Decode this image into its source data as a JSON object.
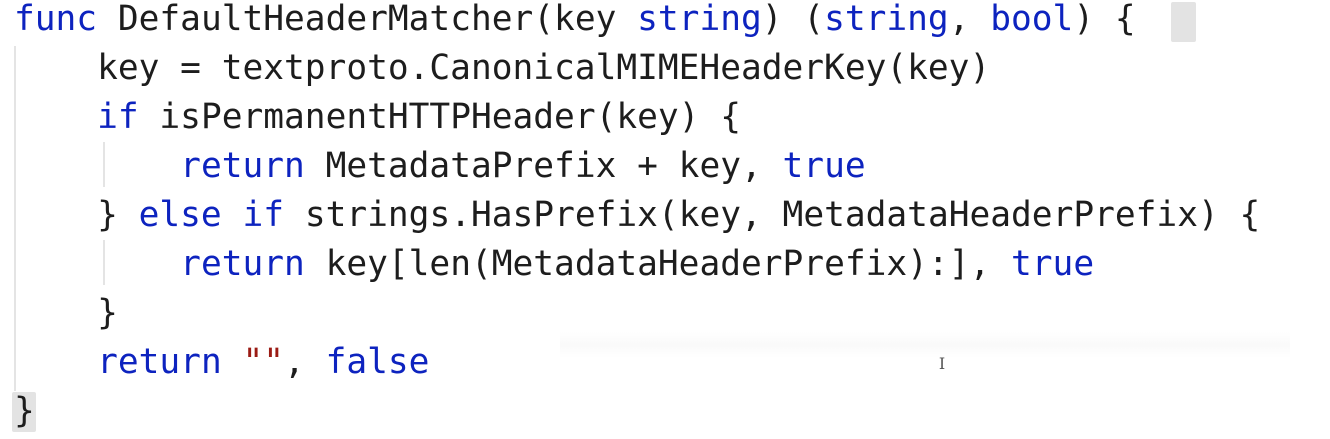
{
  "code": {
    "lines": [
      [
        {
          "t": "func",
          "c": "kw"
        },
        {
          "t": " DefaultHeaderMatcher(key ",
          "c": ""
        },
        {
          "t": "string",
          "c": "kw"
        },
        {
          "t": ") (",
          "c": ""
        },
        {
          "t": "string",
          "c": "kw"
        },
        {
          "t": ", ",
          "c": ""
        },
        {
          "t": "bool",
          "c": "kw"
        },
        {
          "t": ") {",
          "c": ""
        }
      ],
      [
        {
          "t": "    key = textproto.CanonicalMIMEHeaderKey(key)",
          "c": ""
        }
      ],
      [
        {
          "t": "    ",
          "c": ""
        },
        {
          "t": "if",
          "c": "kw"
        },
        {
          "t": " isPermanentHTTPHeader(key) {",
          "c": ""
        }
      ],
      [
        {
          "t": "        ",
          "c": ""
        },
        {
          "t": "return",
          "c": "kw"
        },
        {
          "t": " MetadataPrefix + key, ",
          "c": ""
        },
        {
          "t": "true",
          "c": "kw"
        }
      ],
      [
        {
          "t": "    } ",
          "c": ""
        },
        {
          "t": "else",
          "c": "kw"
        },
        {
          "t": " ",
          "c": ""
        },
        {
          "t": "if",
          "c": "kw"
        },
        {
          "t": " strings.HasPrefix(key, MetadataHeaderPrefix) {",
          "c": ""
        }
      ],
      [
        {
          "t": "        ",
          "c": ""
        },
        {
          "t": "return",
          "c": "kw"
        },
        {
          "t": " key[len(MetadataHeaderPrefix):], ",
          "c": ""
        },
        {
          "t": "true",
          "c": "kw"
        }
      ],
      [
        {
          "t": "    }",
          "c": ""
        }
      ],
      [
        {
          "t": "    ",
          "c": ""
        },
        {
          "t": "return",
          "c": "kw"
        },
        {
          "t": " ",
          "c": ""
        },
        {
          "t": "\"\"",
          "c": "str"
        },
        {
          "t": ", ",
          "c": ""
        },
        {
          "t": "false",
          "c": "kw"
        }
      ],
      [
        {
          "t": "}",
          "c": ""
        }
      ]
    ]
  },
  "colors": {
    "keyword": "#0d23bf",
    "string": "#9b1b14",
    "text": "#1d1d1d",
    "background": "#ffffff"
  },
  "cursor_icon": "text-cursor-icon"
}
